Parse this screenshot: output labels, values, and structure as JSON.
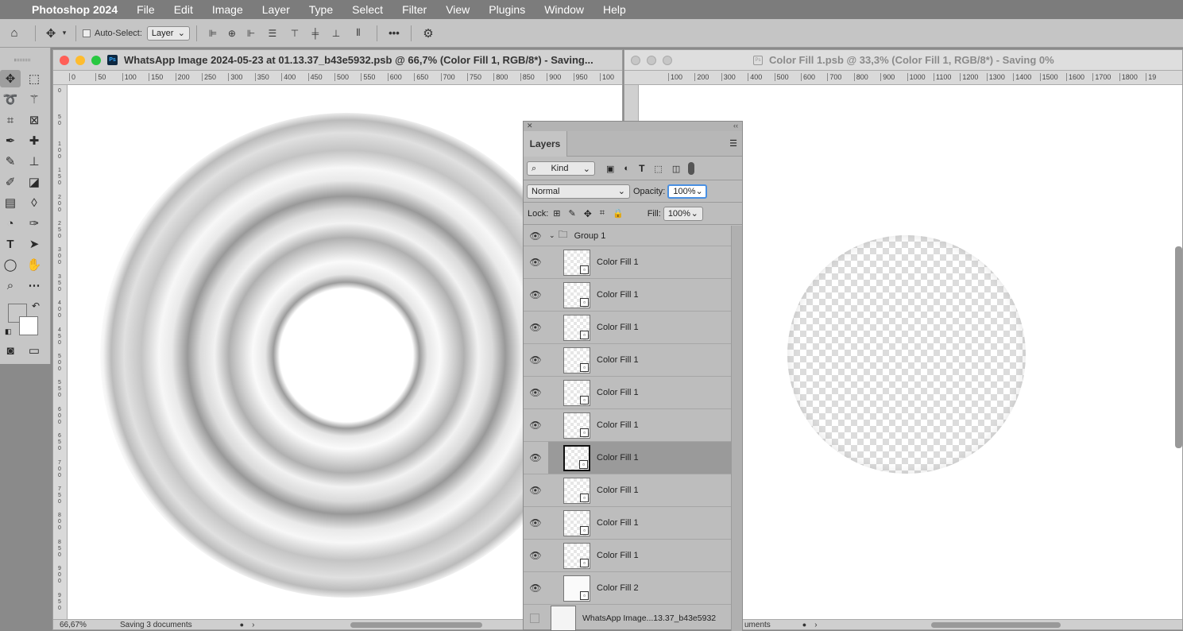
{
  "menubar": {
    "app_name": "Photoshop 2024",
    "items": [
      "File",
      "Edit",
      "Image",
      "Layer",
      "Type",
      "Select",
      "Filter",
      "View",
      "Plugins",
      "Window",
      "Help"
    ]
  },
  "options": {
    "auto_select_label": "Auto-Select:",
    "auto_select_value": "Layer",
    "more_label": "•••"
  },
  "doc1": {
    "title": "WhatsApp Image 2024-05-23 at 01.13.37_b43e5932.psb @ 66,7% (Color Fill 1, RGB/8*) - Saving...",
    "ruler_h": [
      "0",
      "50",
      "100",
      "150",
      "200",
      "250",
      "300",
      "350",
      "400",
      "450",
      "500",
      "550",
      "600",
      "650",
      "700",
      "750",
      "800",
      "850",
      "900",
      "950",
      "100"
    ],
    "ruler_v": [
      "0",
      "5 0",
      "1 0 0",
      "1 5 0",
      "2 0 0",
      "2 5 0",
      "3 0 0",
      "3 5 0",
      "4 0 0",
      "4 5 0",
      "5 0 0",
      "5 5 0",
      "6 0 0",
      "6 5 0",
      "7 0 0",
      "7 5 0",
      "8 0 0",
      "8 5 0",
      "9 0 0",
      "9 5 0"
    ],
    "zoom": "66,67%",
    "status": "Saving 3 documents"
  },
  "doc2": {
    "title": "Color Fill 1.psb @ 33,3% (Color Fill 1, RGB/8*) - Saving 0%",
    "ruler_h": [
      "100",
      "200",
      "300",
      "400",
      "500",
      "600",
      "700",
      "800",
      "900",
      "1000",
      "1100",
      "1200",
      "1300",
      "1400",
      "1500",
      "1600",
      "1700",
      "1800",
      "19"
    ],
    "status": "uments"
  },
  "layers": {
    "tab": "Layers",
    "filter_kind": "Kind",
    "blend_mode": "Normal",
    "opacity_label": "Opacity:",
    "opacity": "100%",
    "lock_label": "Lock:",
    "fill_label": "Fill:",
    "fill": "100%",
    "group_name": "Group 1",
    "rows": [
      "Color Fill 1",
      "Color Fill 1",
      "Color Fill 1",
      "Color Fill 1",
      "Color Fill 1",
      "Color Fill 1",
      "Color Fill 1",
      "Color Fill 1",
      "Color Fill 1",
      "Color Fill 1",
      "Color Fill 2"
    ],
    "selected_index": 6,
    "bottom_layer": "WhatsApp Image...13.37_b43e5932"
  }
}
